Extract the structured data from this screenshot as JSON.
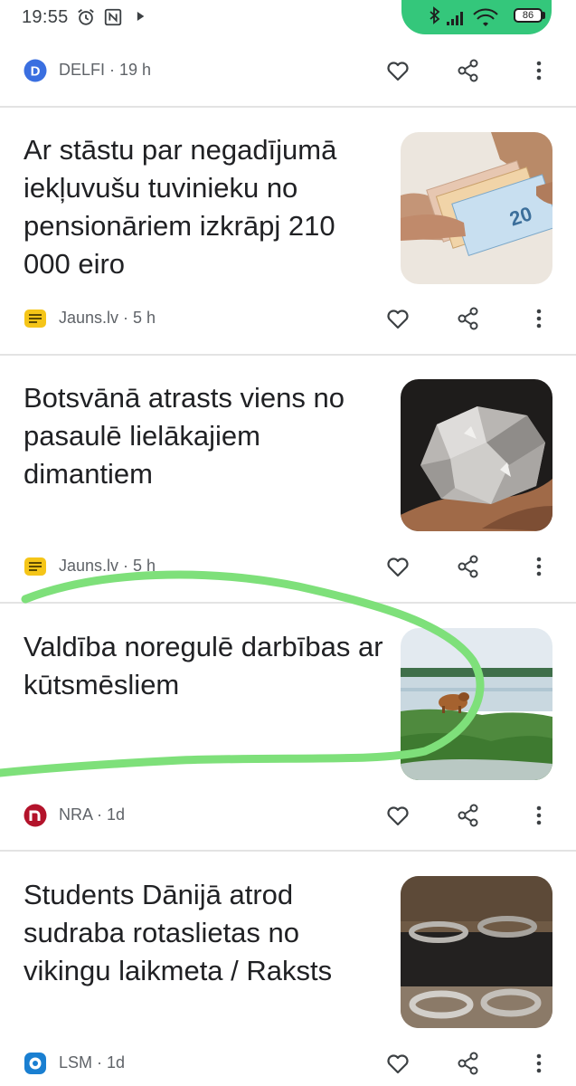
{
  "status_bar": {
    "time": "19:55",
    "battery": "86",
    "icons": [
      "alarm-icon",
      "nfc-icon",
      "play-icon",
      "bluetooth-icon",
      "signal-icon",
      "wifi-icon",
      "battery-icon"
    ]
  },
  "top_source": {
    "text": "DELFI · 19 h",
    "logo_letter": "D",
    "logo_color": "#3a6fe0"
  },
  "articles": [
    {
      "headline": "Ar stāstu par negadījumā iekļuvušu tuvinieku no pensionāriem izkrāpj 210 000 eiro",
      "source": "Jauns.lv · 5 h",
      "image": "euro-banknotes-in-hand"
    },
    {
      "headline": "Botsvānā atrasts viens no pasaulē lielākajiem dimantiem",
      "source": "Jauns.lv · 5 h",
      "image": "rough-diamond-in-hand"
    },
    {
      "headline": "Valdība noregulē darbības ar kūtsmēsliem",
      "source": "NRA · 1d",
      "image": "cow-on-grassy-shore"
    },
    {
      "headline": "Students Dānijā atrod sudraba rotaslietas no vikingu laikmeta / Raksts",
      "source": "LSM · 1d",
      "image": "viking-silver-jewelry"
    }
  ],
  "colors": {
    "jauns_logo": "#f5c518",
    "nra_logo": "#b3132b",
    "lsm_logo": "#1a7fd1",
    "highlight_stroke": "#7ee07a",
    "status_pill": "#34c77b"
  }
}
